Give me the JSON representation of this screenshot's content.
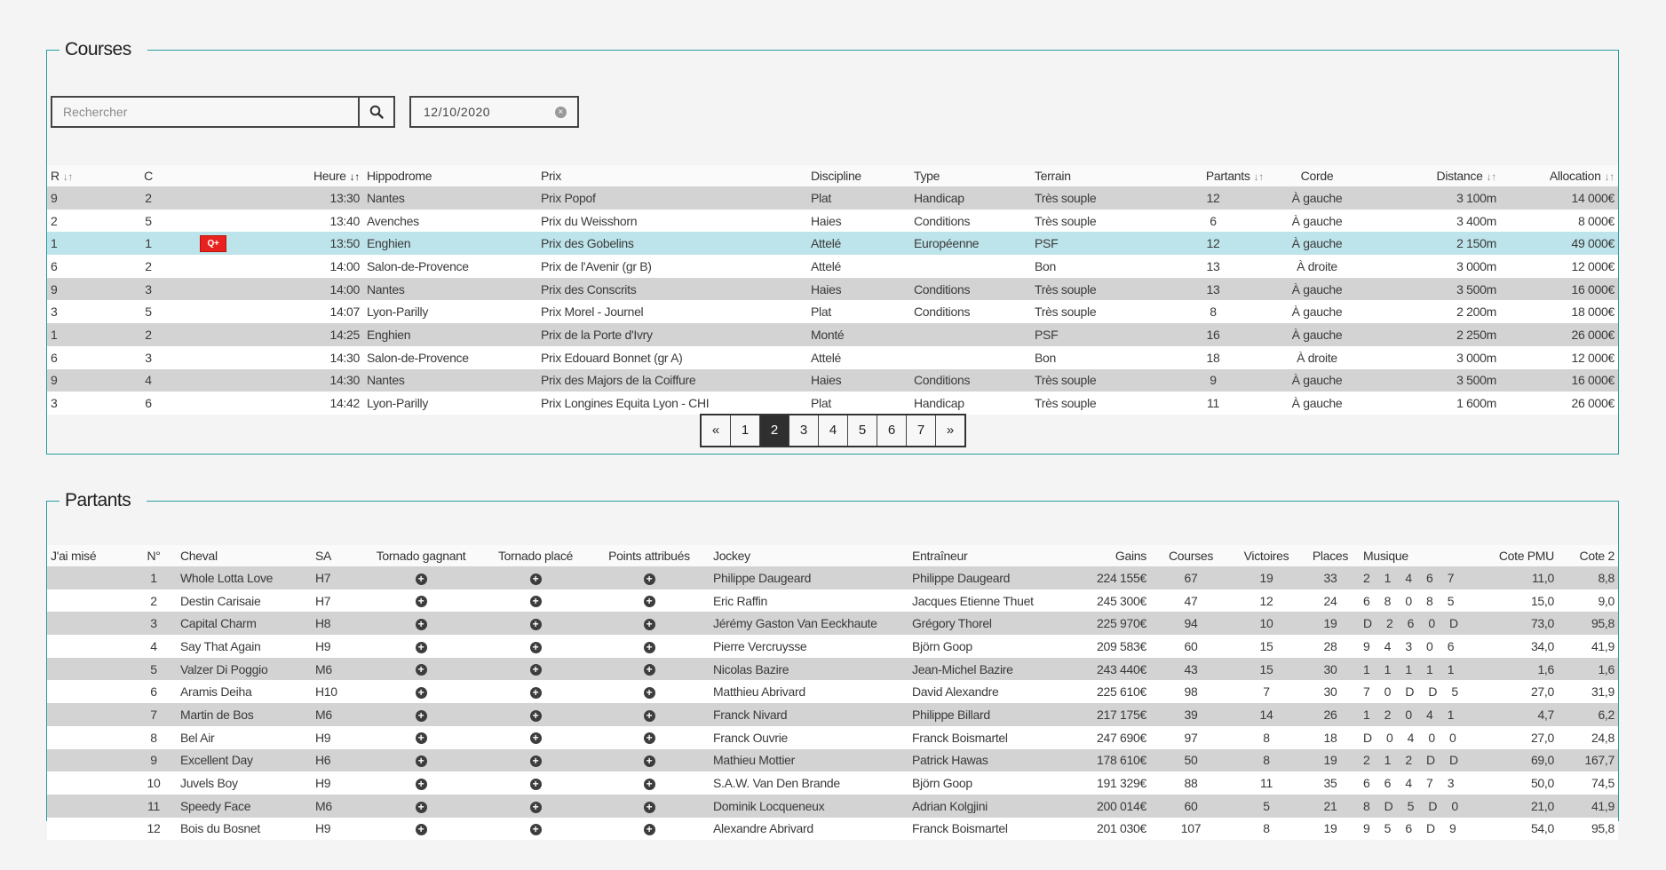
{
  "courses": {
    "title": "Courses",
    "search_placeholder": "Rechercher",
    "date": "12/10/2020",
    "columns": [
      "R",
      "C",
      "",
      "Heure",
      "Hippodrome",
      "Prix",
      "Discipline",
      "Type",
      "Terrain",
      "Partants",
      "Corde",
      "Distance",
      "Allocation"
    ],
    "rows": [
      {
        "r": "9",
        "c": "2",
        "badge": "",
        "heure": "13:30",
        "hippodrome": "Nantes",
        "prix": "Prix Popof",
        "discipline": "Plat",
        "type": "Handicap",
        "terrain": "Très souple",
        "partants": "12",
        "corde": "À gauche",
        "distance": "3 100m",
        "allocation": "14 000€"
      },
      {
        "r": "2",
        "c": "5",
        "badge": "",
        "heure": "13:40",
        "hippodrome": "Avenches",
        "prix": "Prix du Weisshorn",
        "discipline": "Haies",
        "type": "Conditions",
        "terrain": "Très souple",
        "partants": "6",
        "corde": "À gauche",
        "distance": "3 400m",
        "allocation": "8 000€"
      },
      {
        "r": "1",
        "c": "1",
        "badge": "Q+",
        "heure": "13:50",
        "hippodrome": "Enghien",
        "prix": "Prix des Gobelins",
        "discipline": "Attelé",
        "type": "Européenne",
        "terrain": "PSF",
        "partants": "12",
        "corde": "À gauche",
        "distance": "2 150m",
        "allocation": "49 000€",
        "selected": true
      },
      {
        "r": "6",
        "c": "2",
        "badge": "",
        "heure": "14:00",
        "hippodrome": "Salon-de-Provence",
        "prix": "Prix de l'Avenir (gr B)",
        "discipline": "Attelé",
        "type": "",
        "terrain": "Bon",
        "partants": "13",
        "corde": "À droite",
        "distance": "3 000m",
        "allocation": "12 000€"
      },
      {
        "r": "9",
        "c": "3",
        "badge": "",
        "heure": "14:00",
        "hippodrome": "Nantes",
        "prix": "Prix des Conscrits",
        "discipline": "Haies",
        "type": "Conditions",
        "terrain": "Très souple",
        "partants": "13",
        "corde": "À gauche",
        "distance": "3 500m",
        "allocation": "16 000€"
      },
      {
        "r": "3",
        "c": "5",
        "badge": "",
        "heure": "14:07",
        "hippodrome": "Lyon-Parilly",
        "prix": "Prix Morel - Journel",
        "discipline": "Plat",
        "type": "Conditions",
        "terrain": "Très souple",
        "partants": "8",
        "corde": "À gauche",
        "distance": "2 200m",
        "allocation": "18 000€"
      },
      {
        "r": "1",
        "c": "2",
        "badge": "",
        "heure": "14:25",
        "hippodrome": "Enghien",
        "prix": "Prix de la Porte d'Ivry",
        "discipline": "Monté",
        "type": "",
        "terrain": "PSF",
        "partants": "16",
        "corde": "À gauche",
        "distance": "2 250m",
        "allocation": "26 000€"
      },
      {
        "r": "6",
        "c": "3",
        "badge": "",
        "heure": "14:30",
        "hippodrome": "Salon-de-Provence",
        "prix": "Prix Edouard Bonnet (gr A)",
        "discipline": "Attelé",
        "type": "",
        "terrain": "Bon",
        "partants": "18",
        "corde": "À droite",
        "distance": "3 000m",
        "allocation": "12 000€"
      },
      {
        "r": "9",
        "c": "4",
        "badge": "",
        "heure": "14:30",
        "hippodrome": "Nantes",
        "prix": "Prix des Majors de la Coiffure",
        "discipline": "Haies",
        "type": "Conditions",
        "terrain": "Très souple",
        "partants": "9",
        "corde": "À gauche",
        "distance": "3 500m",
        "allocation": "16 000€"
      },
      {
        "r": "3",
        "c": "6",
        "badge": "",
        "heure": "14:42",
        "hippodrome": "Lyon-Parilly",
        "prix": "Prix Longines Equita Lyon - CHI",
        "discipline": "Plat",
        "type": "Handicap",
        "terrain": "Très souple",
        "partants": "11",
        "corde": "À gauche",
        "distance": "1 600m",
        "allocation": "26 000€"
      }
    ],
    "pagination": {
      "prev": "«",
      "pages": [
        "1",
        "2",
        "3",
        "4",
        "5",
        "6",
        "7"
      ],
      "active": "2",
      "next": "»"
    }
  },
  "partants": {
    "title": "Partants",
    "columns": [
      "J'ai misé",
      "N°",
      "Cheval",
      "SA",
      "Tornado gagnant",
      "Tornado placé",
      "Points attribués",
      "Jockey",
      "Entraîneur",
      "Gains",
      "Courses",
      "Victoires",
      "Places",
      "Musique",
      "Cote PMU",
      "Cote 2"
    ],
    "rows": [
      {
        "n": "1",
        "cheval": "Whole Lotta Love",
        "sa": "H7",
        "jockey": "Philippe Daugeard",
        "entraineur": "Philippe Daugeard",
        "gains": "224 155€",
        "courses": "67",
        "victoires": "19",
        "places": "33",
        "musique": "2 1 4 6 7",
        "cote_pmu": "11,0",
        "cote2": "8,8"
      },
      {
        "n": "2",
        "cheval": "Destin Carisaie",
        "sa": "H7",
        "jockey": "Eric Raffin",
        "entraineur": "Jacques Etienne Thuet",
        "gains": "245 300€",
        "courses": "47",
        "victoires": "12",
        "places": "24",
        "musique": "6 8 0 8 5",
        "cote_pmu": "15,0",
        "cote2": "9,0"
      },
      {
        "n": "3",
        "cheval": "Capital Charm",
        "sa": "H8",
        "jockey": "Jérémy Gaston Van Eeckhaute",
        "entraineur": "Grégory Thorel",
        "gains": "225 970€",
        "courses": "94",
        "victoires": "10",
        "places": "19",
        "musique": "D 2 6 0 D",
        "cote_pmu": "73,0",
        "cote2": "95,8"
      },
      {
        "n": "4",
        "cheval": "Say That Again",
        "sa": "H9",
        "jockey": "Pierre Vercruysse",
        "entraineur": "Björn Goop",
        "gains": "209 583€",
        "courses": "60",
        "victoires": "15",
        "places": "28",
        "musique": "9 4 3 0 6",
        "cote_pmu": "34,0",
        "cote2": "41,9"
      },
      {
        "n": "5",
        "cheval": "Valzer Di Poggio",
        "sa": "M6",
        "jockey": "Nicolas Bazire",
        "entraineur": "Jean-Michel Bazire",
        "gains": "243 440€",
        "courses": "43",
        "victoires": "15",
        "places": "30",
        "musique": "1 1 1 1 1",
        "cote_pmu": "1,6",
        "cote2": "1,6"
      },
      {
        "n": "6",
        "cheval": "Aramis Deiha",
        "sa": "H10",
        "jockey": "Matthieu Abrivard",
        "entraineur": "David Alexandre",
        "gains": "225 610€",
        "courses": "98",
        "victoires": "7",
        "places": "30",
        "musique": "7 0 D D 5",
        "cote_pmu": "27,0",
        "cote2": "31,9"
      },
      {
        "n": "7",
        "cheval": "Martin de Bos",
        "sa": "M6",
        "jockey": "Franck Nivard",
        "entraineur": "Philippe Billard",
        "gains": "217 175€",
        "courses": "39",
        "victoires": "14",
        "places": "26",
        "musique": "1 2 0 4 1",
        "cote_pmu": "4,7",
        "cote2": "6,2"
      },
      {
        "n": "8",
        "cheval": "Bel Air",
        "sa": "H9",
        "jockey": "Franck Ouvrie",
        "entraineur": "Franck Boismartel",
        "gains": "247 690€",
        "courses": "97",
        "victoires": "8",
        "places": "18",
        "musique": "D 0 4 0 0",
        "cote_pmu": "27,0",
        "cote2": "24,8"
      },
      {
        "n": "9",
        "cheval": "Excellent Day",
        "sa": "H6",
        "jockey": "Mathieu Mottier",
        "entraineur": "Patrick Hawas",
        "gains": "178 610€",
        "courses": "50",
        "victoires": "8",
        "places": "19",
        "musique": "2 1 2 D D",
        "cote_pmu": "69,0",
        "cote2": "167,7"
      },
      {
        "n": "10",
        "cheval": "Juvels Boy",
        "sa": "H9",
        "jockey": "S.A.W. Van Den Brande",
        "entraineur": "Björn Goop",
        "gains": "191 329€",
        "courses": "88",
        "victoires": "11",
        "places": "35",
        "musique": "6 6 4 7 3",
        "cote_pmu": "50,0",
        "cote2": "74,5"
      },
      {
        "n": "11",
        "cheval": "Speedy Face",
        "sa": "M6",
        "jockey": "Dominik Locqueneux",
        "entraineur": "Adrian Kolgjini",
        "gains": "200 014€",
        "courses": "60",
        "victoires": "5",
        "places": "21",
        "musique": "8 D 5 D 0",
        "cote_pmu": "21,0",
        "cote2": "41,9"
      },
      {
        "n": "12",
        "cheval": "Bois du Bosnet",
        "sa": "H9",
        "jockey": "Alexandre Abrivard",
        "entraineur": "Franck Boismartel",
        "gains": "201 030€",
        "courses": "107",
        "victoires": "8",
        "places": "19",
        "musique": "9 5 6 D 9",
        "cote_pmu": "54,0",
        "cote2": "95,8"
      }
    ]
  },
  "icons": {
    "search": "search-icon",
    "clear": "clear-icon",
    "add": "plus-circle-icon",
    "sort": "sort-arrows-icon"
  },
  "colors": {
    "accent": "#2a9d9d",
    "selected_row": "#bde4ea",
    "odd_row": "#d3d3d3",
    "badge": "#e8231f"
  }
}
